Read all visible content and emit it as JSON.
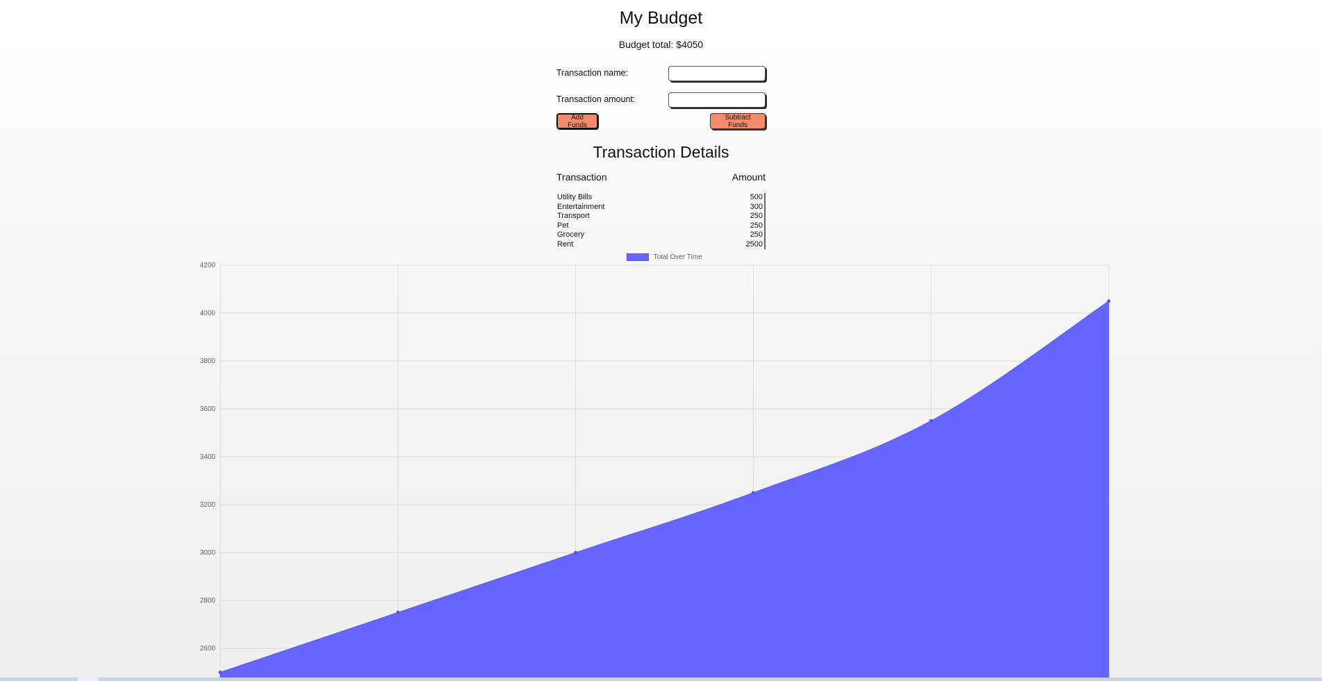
{
  "header": {
    "title": "My Budget",
    "total_label": "Budget total: $4050"
  },
  "form": {
    "name_label": "Transaction name:",
    "name_value": "",
    "amount_label": "Transaction amount:",
    "amount_value": "",
    "add_label": "Add Funds",
    "subtract_label": "Subtract Funds"
  },
  "details": {
    "title": "Transaction Details",
    "columns": [
      "Transaction",
      "Amount"
    ],
    "rows": [
      {
        "name": "Utility Bills",
        "amount": "500"
      },
      {
        "name": "Entertainment",
        "amount": "300"
      },
      {
        "name": "Transport",
        "amount": "250"
      },
      {
        "name": "Pet",
        "amount": "250"
      },
      {
        "name": "Grocery",
        "amount": "250"
      },
      {
        "name": "Rent",
        "amount": "2500"
      }
    ]
  },
  "colors": {
    "button": "#f58b6b",
    "area": "#6666ff",
    "point": "#5555dd"
  },
  "chart_data": {
    "type": "area",
    "series": [
      {
        "name": "Total Over Time",
        "values": [
          2500,
          2750,
          3000,
          3250,
          3550,
          4050
        ]
      }
    ],
    "ylim": [
      2500,
      4200
    ],
    "yticks": [
      2600,
      2800,
      3000,
      3200,
      3400,
      3600,
      3800,
      4000,
      4200
    ],
    "grid": true,
    "legend": "top-center"
  }
}
